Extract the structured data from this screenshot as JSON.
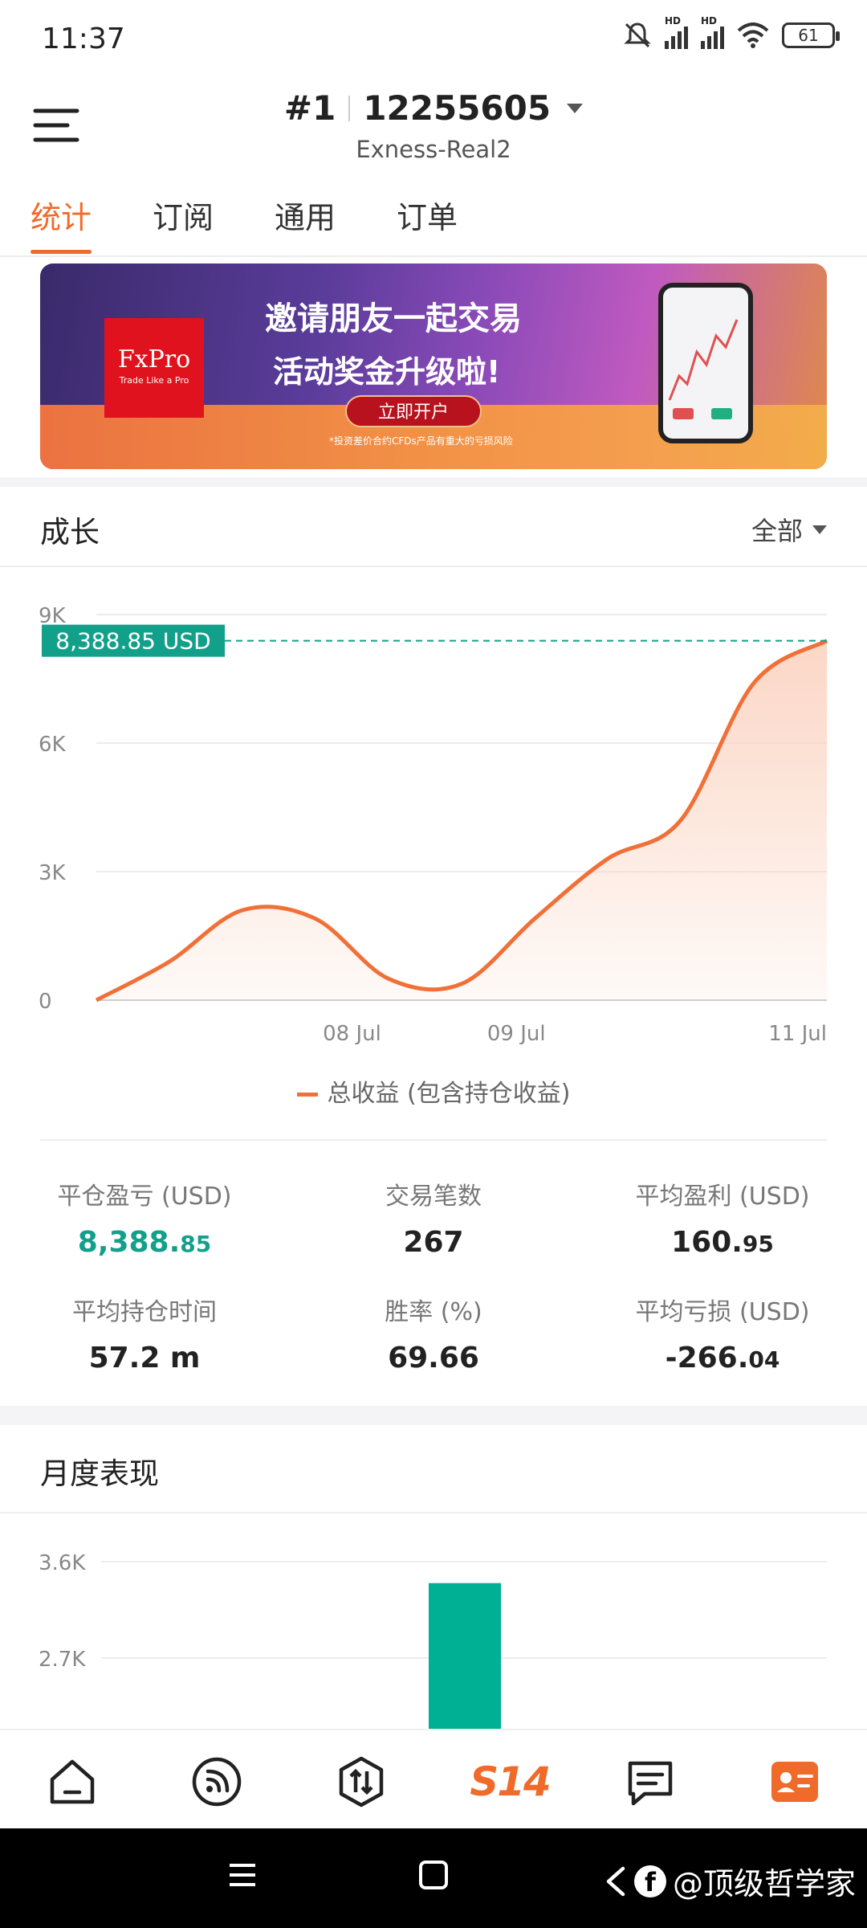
{
  "status_bar": {
    "time": "11:37",
    "battery": "61",
    "net_labels": [
      "HD",
      "HD"
    ]
  },
  "header": {
    "account_index": "#1",
    "account_number": "12255605",
    "server": "Exness-Real2"
  },
  "tabs": [
    {
      "label": "统计",
      "active": true
    },
    {
      "label": "订阅",
      "active": false
    },
    {
      "label": "通用",
      "active": false
    },
    {
      "label": "订单",
      "active": false
    }
  ],
  "banner": {
    "brand": "FxPro",
    "brand_tagline": "Trade Like a Pro",
    "headline1": "邀请朋友一起交易",
    "headline2": "活动奖金升级啦!",
    "cta": "立即开户",
    "disclaimer": "*投资差价合约CFDs产品有重大的亏损风险"
  },
  "growth": {
    "title": "成长",
    "range_selector": "全部",
    "legend": "总收益 (包含持仓收益)"
  },
  "chart_data": [
    {
      "type": "area",
      "y_ticks": [
        "9K",
        "6K",
        "3K",
        "0"
      ],
      "x_ticks": [
        "08 Jul",
        "09 Jul",
        "11 Jul"
      ],
      "ylim": [
        0,
        9000
      ],
      "current_value_label": "8,388.85 USD",
      "x": [
        0,
        0.1,
        0.2,
        0.3,
        0.4,
        0.5,
        0.6,
        0.7,
        0.8,
        0.9,
        1.0
      ],
      "series": [
        {
          "name": "总收益 (包含持仓收益)",
          "values": [
            0,
            900,
            2100,
            1900,
            500,
            380,
            1900,
            3300,
            4200,
            7400,
            8388.85
          ]
        }
      ],
      "colors": {
        "line": "#f07038",
        "fill": "#fbd2bf",
        "marker": "#13a08a"
      }
    },
    {
      "type": "bar",
      "y_ticks": [
        "3.6K",
        "2.7K"
      ],
      "ylim": [
        0,
        3600
      ],
      "values": [
        3400
      ],
      "colors": {
        "bar": "#00b095"
      }
    }
  ],
  "stats": [
    {
      "label": "平仓盈亏 (USD)",
      "int": "8,388.",
      "dec": "85",
      "green": true
    },
    {
      "label": "交易笔数",
      "int": "267",
      "dec": "",
      "green": false
    },
    {
      "label": "平均盈利 (USD)",
      "int": "160.",
      "dec": "95",
      "green": false
    },
    {
      "label": "平均持仓时间",
      "int": "57.2 m",
      "dec": "",
      "green": false
    },
    {
      "label": "胜率 (%)",
      "int": "69.66",
      "dec": "",
      "green": false
    },
    {
      "label": "平均亏损 (USD)",
      "int": "-266.",
      "dec": "04",
      "green": false
    }
  ],
  "monthly": {
    "title": "月度表现"
  },
  "bottom_nav": [
    {
      "name": "home"
    },
    {
      "name": "signals"
    },
    {
      "name": "trade"
    },
    {
      "name": "s14",
      "label": "S14"
    },
    {
      "name": "messages"
    },
    {
      "name": "profile"
    }
  ],
  "watermark": "@顶级哲学家"
}
